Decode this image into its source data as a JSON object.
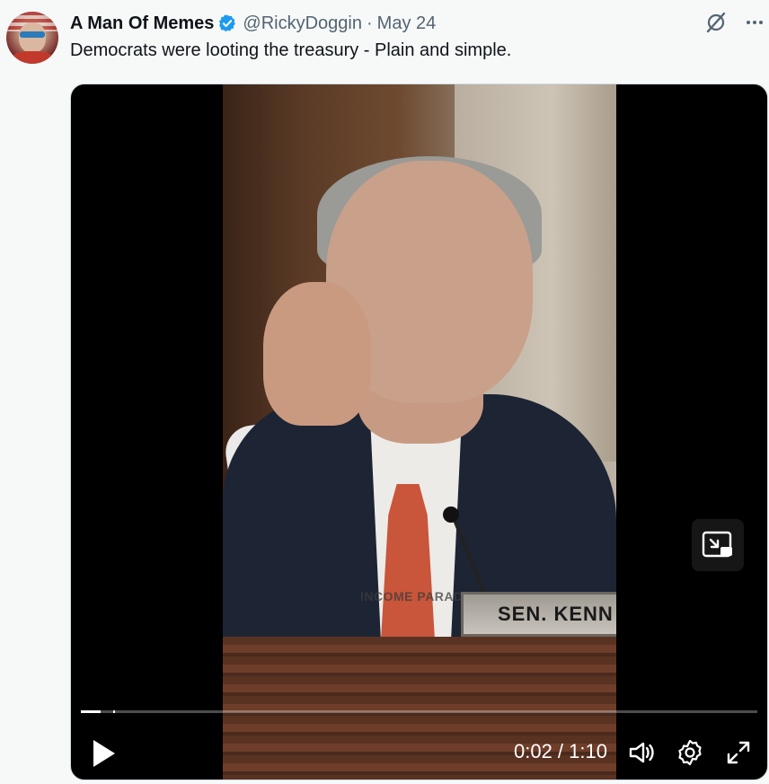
{
  "author": {
    "display_name": "A Man Of Memes",
    "handle": "@RickyDoggin",
    "separator": "·",
    "date": "May 24",
    "verified": true,
    "verified_color": "#1d9bf0"
  },
  "tweet": {
    "text": "Democrats were looting the treasury - Plain and simple."
  },
  "top_icons": [
    "grok-icon",
    "more-options-icon"
  ],
  "video": {
    "watermark": "INCOME PARADE",
    "nameplate": "SEN. KENN",
    "time_display": "0:02 / 1:10",
    "progress_fraction": 0.029,
    "controls": [
      "play-icon",
      "volume-icon",
      "settings-icon",
      "fullscreen-icon"
    ],
    "pip_icon": "picture-in-picture-icon"
  },
  "colors": {
    "background": "#f7f9f9",
    "text": "#0f1419",
    "secondary_text": "#536471",
    "video_bg": "#000000"
  }
}
